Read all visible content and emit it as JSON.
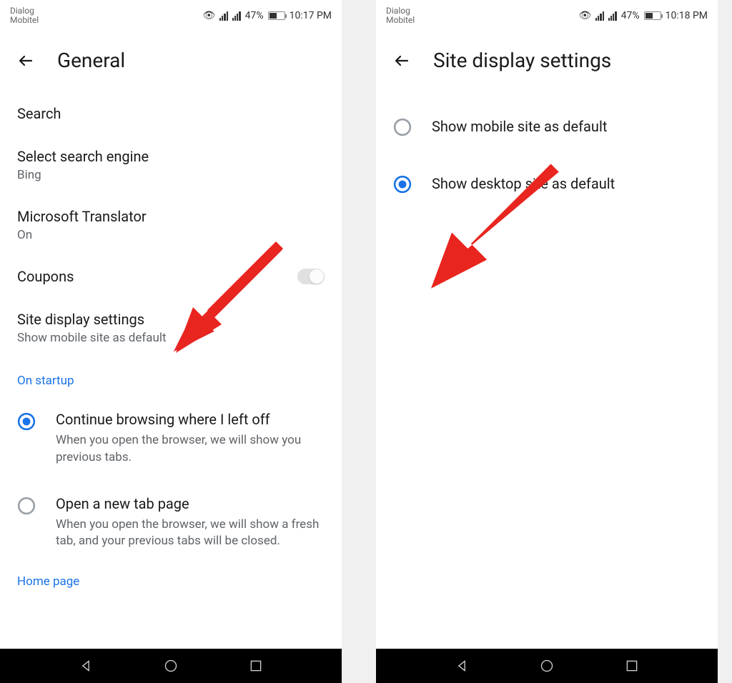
{
  "left": {
    "status": {
      "carrier1": "Dialog",
      "carrier2": "Mobitel",
      "battery_pct": "47%",
      "time": "10:17 PM"
    },
    "header": {
      "title": "General"
    },
    "items": {
      "search_header": "Search",
      "select_engine": {
        "title": "Select search engine",
        "sub": "Bing"
      },
      "translator": {
        "title": "Microsoft Translator",
        "sub": "On"
      },
      "coupons": {
        "title": "Coupons"
      },
      "site_display": {
        "title": "Site display settings",
        "sub": "Show mobile site as default"
      }
    },
    "startup_label": "On startup",
    "radio1": {
      "title": "Continue browsing where I left off",
      "desc": "When you open the browser, we will show you previous tabs."
    },
    "radio2": {
      "title": "Open a new tab page",
      "desc": "When you open the browser, we will show a fresh tab, and your previous tabs will be closed."
    },
    "home_link": "Home page"
  },
  "right": {
    "status": {
      "carrier1": "Dialog",
      "carrier2": "Mobitel",
      "battery_pct": "47%",
      "time": "10:18 PM"
    },
    "header": {
      "title": "Site display settings"
    },
    "opt1": "Show mobile site as default",
    "opt2": "Show desktop site as default"
  }
}
